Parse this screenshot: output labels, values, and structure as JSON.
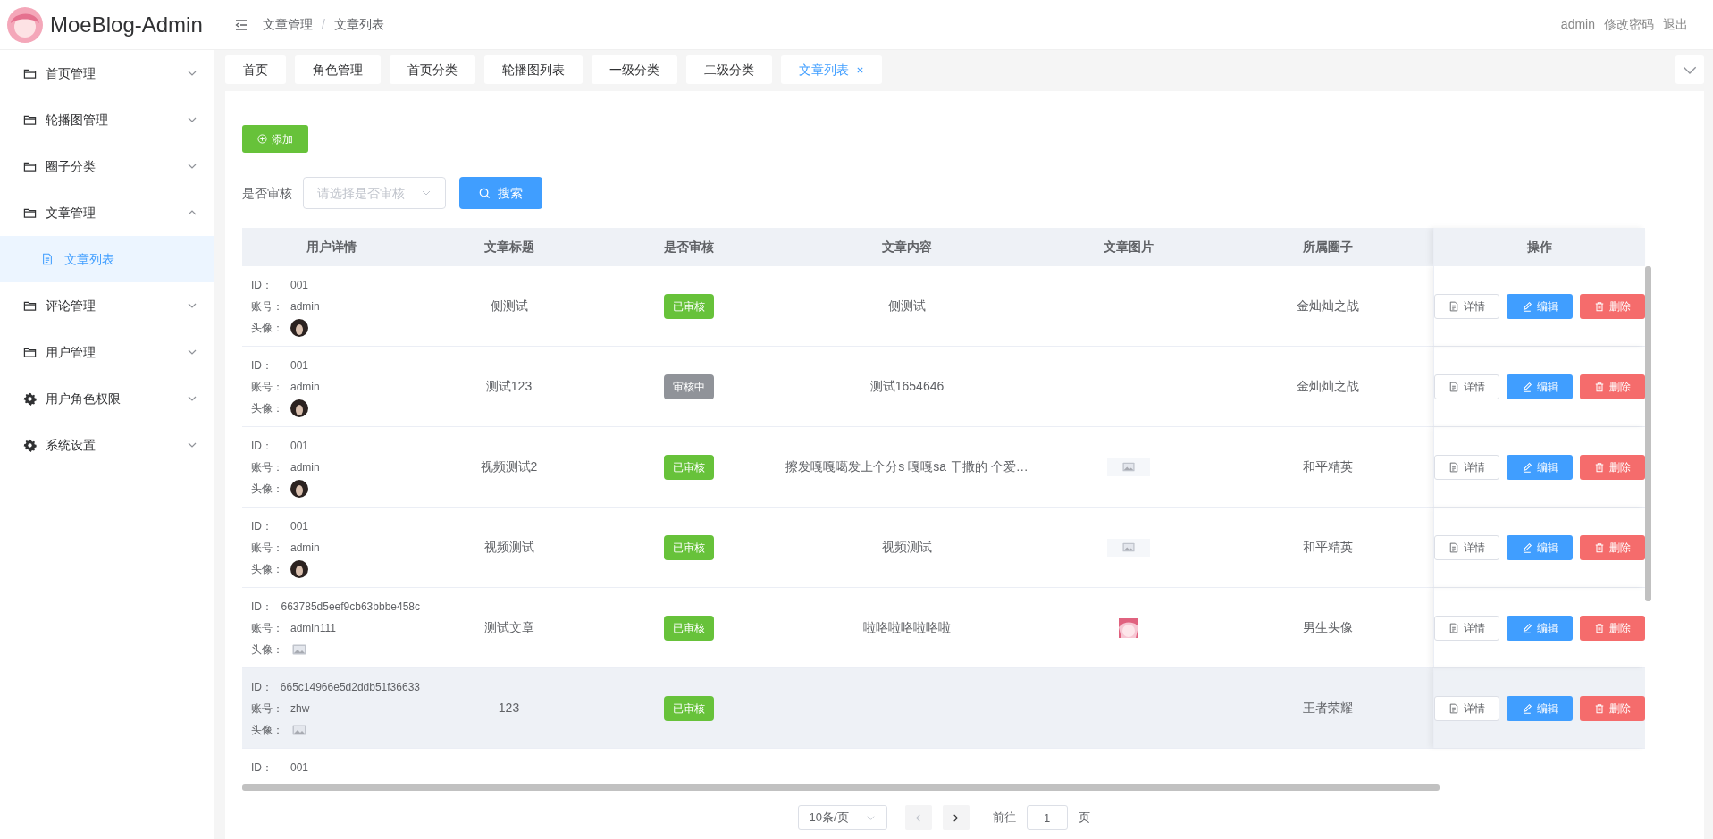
{
  "header": {
    "app_title": "MoeBlog-Admin",
    "breadcrumb": [
      "文章管理",
      "文章列表"
    ],
    "breadcrumb_separator": "/",
    "user": "admin",
    "links": [
      "修改密码",
      "退出"
    ]
  },
  "sidebar": {
    "items": [
      {
        "label": "首页管理",
        "kind": "folder",
        "expanded": false
      },
      {
        "label": "轮播图管理",
        "kind": "folder",
        "expanded": false
      },
      {
        "label": "圈子分类",
        "kind": "folder",
        "expanded": false
      },
      {
        "label": "文章管理",
        "kind": "folder",
        "expanded": true,
        "children": [
          {
            "label": "文章列表",
            "selected": true
          }
        ]
      },
      {
        "label": "评论管理",
        "kind": "folder",
        "expanded": false
      },
      {
        "label": "用户管理",
        "kind": "folder",
        "expanded": false
      },
      {
        "label": "用户角色权限",
        "kind": "gear",
        "expanded": false
      },
      {
        "label": "系统设置",
        "kind": "gear",
        "expanded": false
      }
    ]
  },
  "tabs": [
    {
      "label": "首页",
      "selected": false
    },
    {
      "label": "角色管理",
      "selected": false
    },
    {
      "label": "首页分类",
      "selected": false
    },
    {
      "label": "轮播图列表",
      "selected": false
    },
    {
      "label": "一级分类",
      "selected": false
    },
    {
      "label": "二级分类",
      "selected": false
    },
    {
      "label": "文章列表",
      "selected": true
    }
  ],
  "toolbar": {
    "add_button": "添加",
    "filter_label": "是否审核",
    "filter_placeholder": "请选择是否审核",
    "search_button": "搜索"
  },
  "table": {
    "columns": [
      "用户详情",
      "文章标题",
      "是否审核",
      "文章内容",
      "文章图片",
      "所属圈子",
      "操作"
    ],
    "rows": [
      {
        "user": {
          "id_label": "ID：",
          "id": "001",
          "account_label": "账号：",
          "account": "admin",
          "avatar_label": "头像："
        },
        "title": "侧测试",
        "status": {
          "label": "已审核",
          "approved": true
        },
        "content": "侧测试",
        "circle": "金灿灿之战",
        "actions": [
          "详情",
          "编辑",
          "删除"
        ],
        "highlighted": false
      },
      {
        "user": {
          "id_label": "ID：",
          "id": "001",
          "account_label": "账号：",
          "account": "admin",
          "avatar_label": "头像："
        },
        "title": "测试123",
        "status": {
          "label": "审核中",
          "approved": false
        },
        "content": "测试1654646",
        "circle": "金灿灿之战",
        "actions": [
          "详情",
          "编辑",
          "删除"
        ],
        "highlighted": false
      },
      {
        "user": {
          "id_label": "ID：",
          "id": "001",
          "account_label": "账号：",
          "account": "admin",
          "avatar_label": "头像："
        },
        "title": "视频测试2",
        "status": {
          "label": "已审核",
          "approved": true
        },
        "content": "擦发嘎嘎噶发上个分s 嘎嘎sa 干撒的 个爱…",
        "image": {
          "kind": "broken"
        },
        "circle": "和平精英",
        "actions": [
          "详情",
          "编辑",
          "删除"
        ],
        "highlighted": false
      },
      {
        "user": {
          "id_label": "ID：",
          "id": "001",
          "account_label": "账号：",
          "account": "admin",
          "avatar_label": "头像："
        },
        "title": "视频测试",
        "status": {
          "label": "已审核",
          "approved": true
        },
        "content": "视频测试",
        "image": {
          "kind": "broken"
        },
        "circle": "和平精英",
        "actions": [
          "详情",
          "编辑",
          "删除"
        ],
        "highlighted": false
      },
      {
        "user": {
          "id_label": "ID：",
          "id": "663785d5eef9cb63bbbe458c",
          "account_label": "账号：",
          "account": "admin111",
          "avatar_label": "头像：",
          "avatar": {
            "kind": "broken"
          }
        },
        "title": "测试文章",
        "status": {
          "label": "已审核",
          "approved": true
        },
        "content": "啦咯啦咯啦咯啦",
        "circle": "男生头像",
        "actions": [
          "详情",
          "编辑",
          "删除"
        ],
        "highlighted": false
      },
      {
        "user": {
          "id_label": "ID：",
          "id": "665c14966e5d2ddb51f36633",
          "account_label": "账号：",
          "account": "zhw",
          "avatar_label": "头像：",
          "avatar": {
            "kind": "broken"
          }
        },
        "title": "123",
        "status": {
          "label": "已审核",
          "approved": true
        },
        "circle": "王者荣耀",
        "actions": [
          "详情",
          "编辑",
          "删除"
        ],
        "highlighted": true
      },
      {
        "user": {
          "id_label": "ID：",
          "id": "001"
        }
      }
    ]
  },
  "pagination": {
    "page_size": "10条/页",
    "prev_disabled": true,
    "goto_label": "前往",
    "page": "1",
    "page_suffix": "页"
  }
}
